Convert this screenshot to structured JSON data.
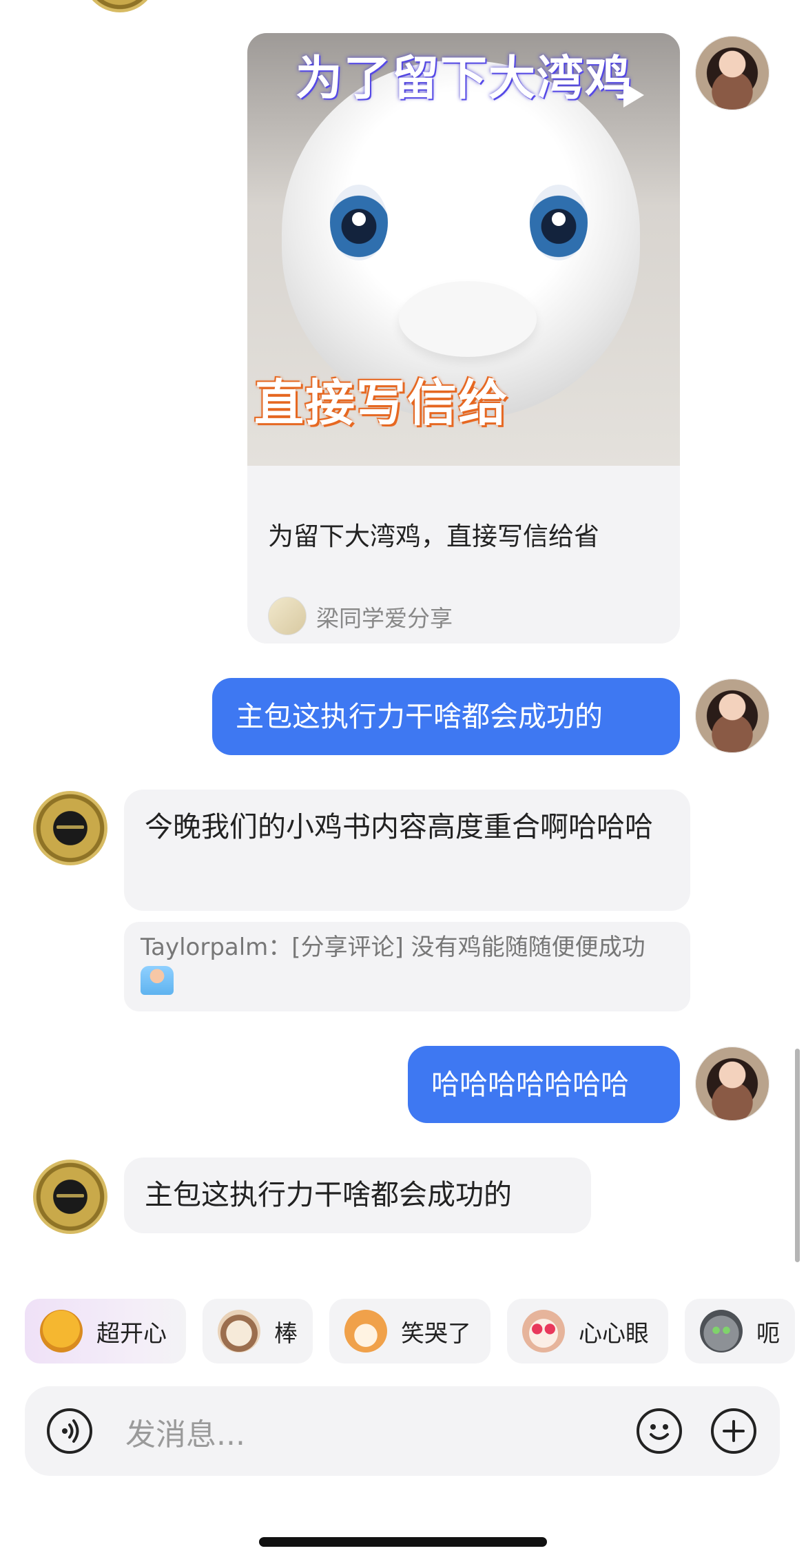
{
  "share_card": {
    "thumb_title": "为了留下大湾鸡",
    "thumb_subtitle": "直接写信给",
    "title": "为留下大湾鸡，直接写信给省",
    "author": "梁同学爱分享"
  },
  "messages": [
    {
      "side": "out",
      "text": "主包这执行力干啥都会成功的"
    },
    {
      "side": "in",
      "text": "今晚我们的小鸡书内容高度重合啊哈哈哈",
      "quote": "Taylorpalm：[分享评论] 没有鸡能随随便便成功"
    },
    {
      "side": "out",
      "text": "哈哈哈哈哈哈哈"
    },
    {
      "side": "in",
      "text": "主包这执行力干啥都会成功的"
    }
  ],
  "quick_reactions": [
    {
      "label": "超开心",
      "icon": "starry-eyes-emoji-icon",
      "color": "#f5b730"
    },
    {
      "label": "棒",
      "icon": "cat-thumbs-up-icon",
      "color": "#e9d2b8"
    },
    {
      "label": "笑哭了",
      "icon": "fox-laughing-icon",
      "color": "#f0a14a"
    },
    {
      "label": "心心眼",
      "icon": "dog-heart-eyes-icon",
      "color": "#e6b49b"
    },
    {
      "label": "呃",
      "icon": "gray-cat-icon",
      "color": "#6e7378"
    }
  ],
  "composer": {
    "placeholder": "发消息..."
  }
}
